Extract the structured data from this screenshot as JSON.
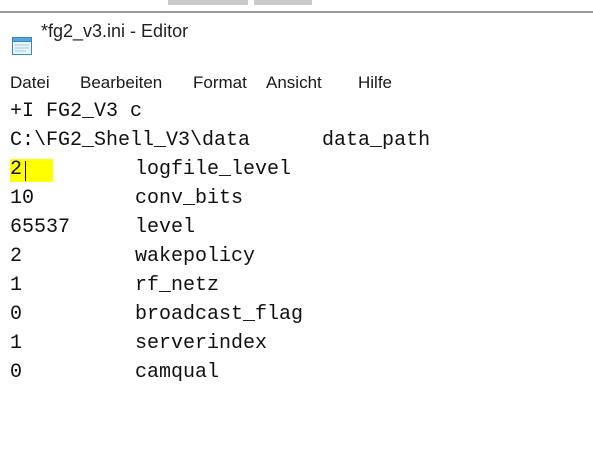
{
  "window": {
    "title": "*fg2_v3.ini - Editor",
    "icon": "notepad-icon"
  },
  "menu": [
    {
      "label": "Datei"
    },
    {
      "label": "Bearbeiten"
    },
    {
      "label": "Format"
    },
    {
      "label": "Ansicht"
    },
    {
      "label": "Hilfe"
    }
  ],
  "editor": {
    "lines": [
      {
        "text": "+I FG2_V3 c"
      },
      {
        "text": "C:\\FG2_Shell_V3\\data      data_path"
      },
      {
        "value": "2",
        "key": "logfile_level"
      },
      {
        "value": "10",
        "key": "conv_bits"
      },
      {
        "value": "65537",
        "key": "level"
      },
      {
        "value": "2",
        "key": "wakepolicy"
      },
      {
        "value": "1",
        "key": "rf_netz"
      },
      {
        "value": "0",
        "key": "broadcast_flag"
      },
      {
        "value": "1",
        "key": "serverindex"
      },
      {
        "value": "0",
        "key": "camqual"
      }
    ],
    "highlight_color": "#ffff00"
  }
}
